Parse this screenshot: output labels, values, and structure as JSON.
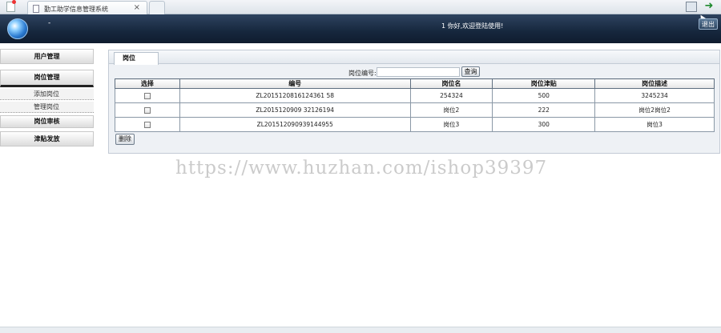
{
  "browser": {
    "tab_title": "勤工助学信息管理系统",
    "tab_close": "×",
    "save_icon": "save-icon",
    "back_icon": "back-arrow-icon",
    "back_color": "#1f8a2e"
  },
  "header": {
    "dash": "-",
    "greeting": "1 你好,欢迎登陆使用!",
    "logout_label": "退出",
    "bg_color": "#16273d"
  },
  "sidebar": {
    "items": [
      {
        "label": "用户管理"
      },
      {
        "label": "岗位管理"
      },
      {
        "label": "添加岗位"
      },
      {
        "label": "管理岗位"
      },
      {
        "label": "岗位审核"
      },
      {
        "label": "津贴发放"
      }
    ]
  },
  "main": {
    "tab_label": "岗位",
    "search": {
      "label": "岗位编号:",
      "value": "",
      "placeholder": "",
      "button_label": "查询"
    },
    "table": {
      "headers": [
        "选择",
        "编号",
        "岗位名",
        "岗位津贴",
        "岗位描述"
      ],
      "rows": [
        {
          "id": "ZL2015120816124361 58",
          "name": "254324",
          "allowance": "500",
          "description": "3245234"
        },
        {
          "id": "ZL2015120909 32126194",
          "name": "岗位2",
          "allowance": "222",
          "description": "岗位2岗位2"
        },
        {
          "id": "ZL201512090939144955",
          "name": "岗位3",
          "allowance": "300",
          "description": "岗位3"
        }
      ]
    },
    "delete_label": "删除"
  },
  "watermark": "https://www.huzhan.com/ishop39397"
}
